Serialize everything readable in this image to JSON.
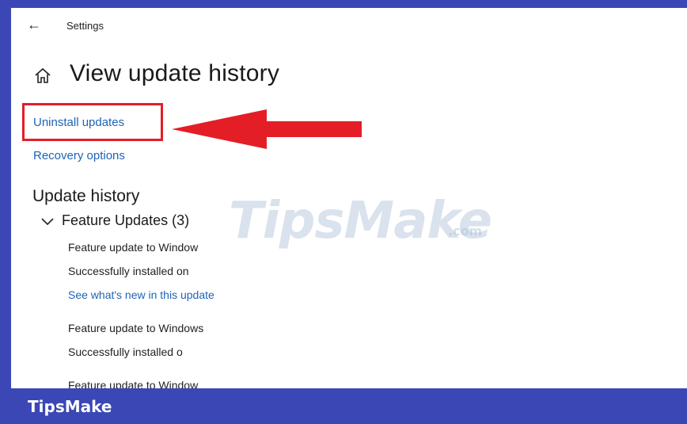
{
  "window": {
    "title": "Settings",
    "page_title": "View update history"
  },
  "links": {
    "uninstall": "Uninstall updates",
    "recovery": "Recovery options"
  },
  "history": {
    "section_title": "Update history",
    "group_label": "Feature Updates (3)",
    "items": [
      {
        "name": "Feature update to Window",
        "status": "Successfully installed on",
        "link": "See what's new in this update"
      },
      {
        "name": "Feature update to Windows",
        "status": "Successfully installed o"
      },
      {
        "name": "Feature update to Window"
      }
    ]
  },
  "watermark": {
    "brand": "TipsMake",
    "suffix": ".com"
  },
  "footer": {
    "brand": "TipsMake"
  },
  "colors": {
    "frame": "#3a47b5",
    "link": "#1e63b8",
    "highlight": "#e41e26"
  },
  "icons": {
    "back": "back-arrow-icon",
    "home": "home-icon",
    "chevron": "chevron-down-icon",
    "annotation_arrow": "red-arrow-icon"
  }
}
